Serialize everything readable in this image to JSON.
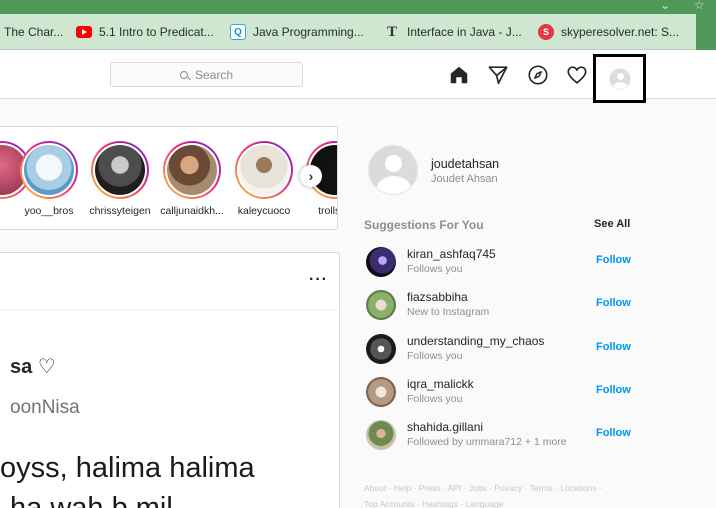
{
  "browser": {
    "bookmarks": [
      {
        "label": "The Char...",
        "icon": "bookmark-icon"
      },
      {
        "label": "5.1 Intro to Predicat...",
        "icon": "youtube-icon"
      },
      {
        "label": "Java Programming...",
        "icon": "q-site-icon"
      },
      {
        "label": "Interface in Java - J...",
        "icon": "t-site-icon"
      },
      {
        "label": "skyperesolver.net: S...",
        "icon": "skyperesolver-icon"
      }
    ]
  },
  "nav": {
    "search_placeholder": "Search",
    "icons": [
      "home-icon",
      "direct-icon",
      "explore-icon",
      "activity-heart-icon",
      "profile-avatar-icon"
    ]
  },
  "stories": {
    "items": [
      {
        "name": ""
      },
      {
        "name": "yoo__bros"
      },
      {
        "name": "chrissyteigen"
      },
      {
        "name": "calljunaidkh..."
      },
      {
        "name": "kaleycuoco"
      },
      {
        "name": "trolls_o"
      }
    ],
    "next_label": "›"
  },
  "post": {
    "more": "···",
    "author_fragment": "sa ♡",
    "handle_fragment": "oonNisa",
    "text_line1": "oyss, halima halima",
    "text_line2": "ha wah b mil"
  },
  "profile": {
    "username": "joudetahsan",
    "full_name": "Joudet Ahsan"
  },
  "suggestions": {
    "title": "Suggestions For You",
    "see_all": "See All",
    "follow_label": "Follow",
    "items": [
      {
        "username": "kiran_ashfaq745",
        "subtitle": "Follows you"
      },
      {
        "username": "fiazsabbiha",
        "subtitle": "New to Instagram"
      },
      {
        "username": "understanding_my_chaos",
        "subtitle": "Follows you"
      },
      {
        "username": "iqra_malickk",
        "subtitle": "Follows you"
      },
      {
        "username": "shahida.gillani",
        "subtitle": "Followed by ummara712 + 1 more"
      }
    ]
  },
  "footer": {
    "line1": "About · Help · Press · API · Jobs · Privacy · Terms · Locations ·",
    "line2": "Top Accounts · Hashtags · Language"
  },
  "colors": {
    "chrome": "#4f9a5a",
    "bookmarks_bar": "#cfe6d1",
    "follow_blue": "#0095f6",
    "border": "#dbdbdb"
  }
}
